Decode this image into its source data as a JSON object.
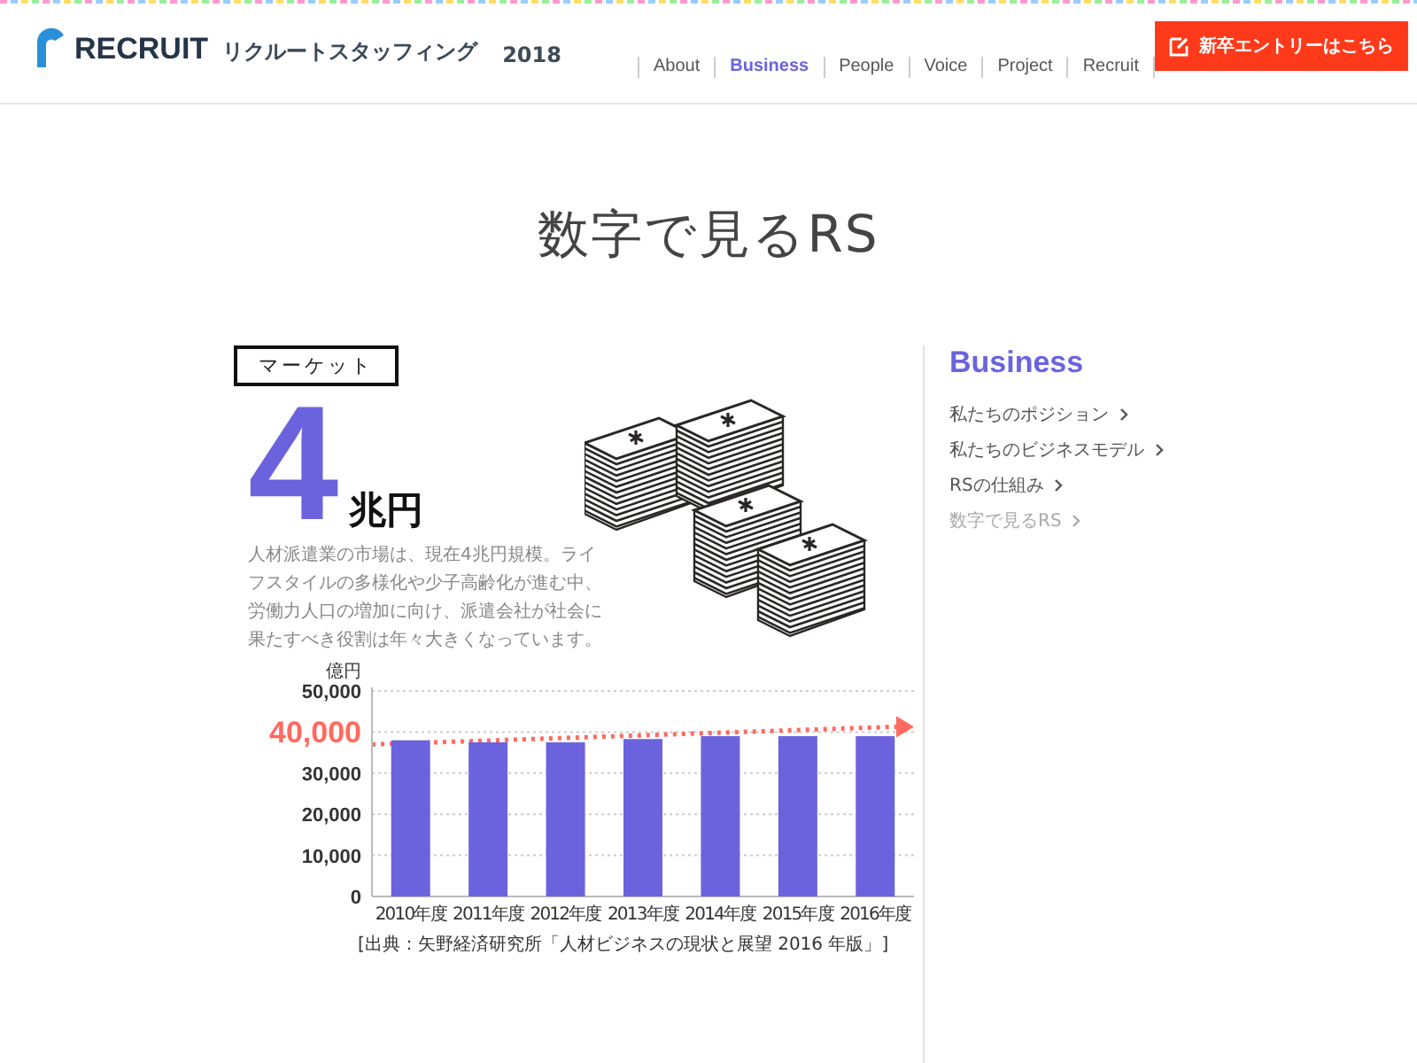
{
  "header": {
    "brand": "RECRUIT",
    "brand_jp": "リクルートスタッフィング",
    "year": "2018",
    "nav": [
      {
        "label": "About",
        "selected": false
      },
      {
        "label": "Business",
        "selected": true
      },
      {
        "label": "People",
        "selected": false
      },
      {
        "label": "Voice",
        "selected": false
      },
      {
        "label": "Project",
        "selected": false
      },
      {
        "label": "Recruit",
        "selected": false
      }
    ],
    "entry_button": "新卒エントリーはこちら"
  },
  "page_title": "数字で見るRS",
  "section": {
    "tag": "マーケット",
    "figure": "4",
    "unit": "兆円",
    "text": "人材派遣業の市場は、現在4兆円規模。ライフスタイルの多様化や少子高齢化が進む中、労働力人口の増加に向け、派遣会社が社会に果たすべき役割は年々大きくなっています。",
    "chart_data": {
      "type": "bar",
      "ylabel": "億円",
      "categories": [
        "2010年度",
        "2011年度",
        "2012年度",
        "2013年度",
        "2014年度",
        "2015年度",
        "2016年度"
      ],
      "series": [
        {
          "color": "#6b63de",
          "values": [
            38000,
            37500,
            37500,
            38300,
            39000,
            39000,
            39000
          ]
        }
      ],
      "grid": true,
      "ylim": [
        0,
        50000
      ],
      "yticks": [
        {
          "value": 0,
          "label": "0"
        },
        {
          "value": 10000,
          "label": "10,000"
        },
        {
          "value": 20000,
          "label": "20,000"
        },
        {
          "value": 30000,
          "label": "30,000"
        },
        {
          "value": 50000,
          "label": "50,000"
        }
      ],
      "annotations": [
        "40,000"
      ]
    },
    "source": "[出典：矢野経済研究所「人材ビジネスの現状と展望 2016 年版」]"
  },
  "sidebar": {
    "title": "Business",
    "items": [
      {
        "label": "私たちのポジション",
        "selected": false
      },
      {
        "label": "私たちのビジネスモデル",
        "selected": false
      },
      {
        "label": "RSの仕組み",
        "selected": false
      },
      {
        "label": "数字で見るRS",
        "selected": true
      }
    ]
  }
}
